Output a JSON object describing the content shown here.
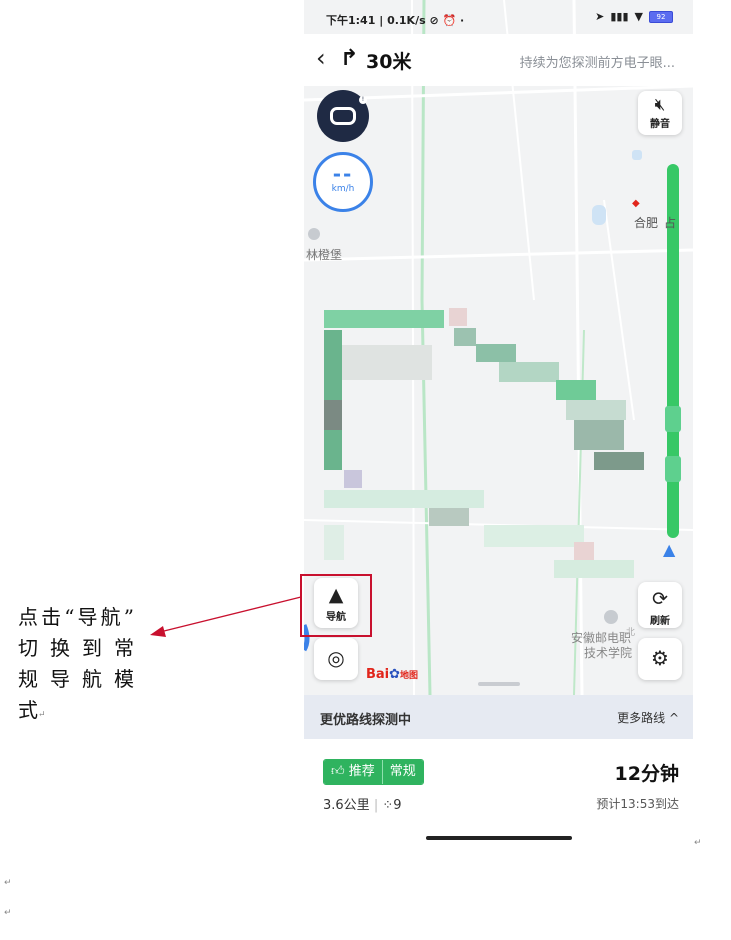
{
  "status": {
    "time": "下午1:41",
    "speed": "0.1K/s",
    "battery": "92"
  },
  "nav": {
    "distance": "30米",
    "hint": "持续为您探测前方电子眼..."
  },
  "map": {
    "speed_value": "--",
    "speed_unit": "km/h",
    "mute_label": "静音",
    "refresh_label": "刷新",
    "navigate_label": "导航",
    "poi_station": "合肥",
    "poi_station_tail": "占",
    "poi_left": "林橙堡",
    "poi_school_1": "安徽邮电职",
    "poi_school_2": "技术学院",
    "poi_school_tag": "北",
    "logo_a": "Bai",
    "logo_b": "地图"
  },
  "route_panel": {
    "better_route": "更优路线探测中",
    "more_routes": "更多路线 ^",
    "tag_recommend": "推荐",
    "tag_normal": "常规",
    "duration": "12分钟",
    "distance": "3.6公里",
    "lights": "9",
    "arrival": "预计13:53到达"
  },
  "annotation": {
    "caption_line1": "点击“导航”",
    "caption_line2": "切换到常",
    "caption_line3": "规导航模",
    "caption_line4": "式"
  },
  "icons": [
    "back-icon",
    "turn-right-icon",
    "robot-icon",
    "mute-icon",
    "navigate-arrow-icon",
    "refresh-icon",
    "locate-icon",
    "settings-icon",
    "car-position-icon",
    "thumb-up-icon",
    "traffic-light-icon"
  ]
}
